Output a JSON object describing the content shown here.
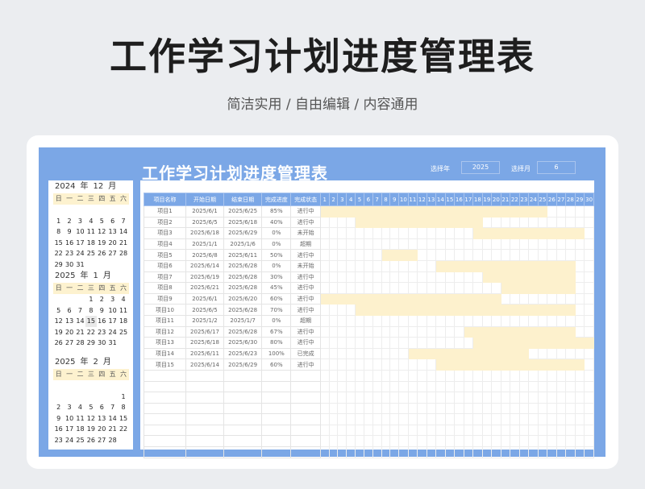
{
  "page": {
    "title": "工作学习计划进度管理表",
    "subtitle": "简洁实用 / 自由编辑 / 内容通用"
  },
  "sheet": {
    "title": "工作学习计划进度管理表",
    "year_label": "选择年",
    "year_value": "2025",
    "month_label": "选择月",
    "month_value": "6"
  },
  "calendars": [
    {
      "year": "2024",
      "year_unit": "年",
      "month": "12",
      "month_unit": "月",
      "weekdays": [
        "日",
        "一",
        "二",
        "三",
        "四",
        "五",
        "六"
      ],
      "days": [
        "",
        "",
        "",
        "",
        "",
        "",
        "",
        "1",
        "2",
        "3",
        "4",
        "5",
        "6",
        "7",
        "8",
        "9",
        "10",
        "11",
        "12",
        "13",
        "14",
        "15",
        "16",
        "17",
        "18",
        "19",
        "20",
        "21",
        "22",
        "23",
        "24",
        "25",
        "26",
        "27",
        "28",
        "29",
        "30",
        "31",
        "",
        "",
        "",
        ""
      ],
      "today": ""
    },
    {
      "year": "2025",
      "year_unit": "年",
      "month": "1",
      "month_unit": "月",
      "weekdays": [
        "日",
        "一",
        "二",
        "三",
        "四",
        "五",
        "六"
      ],
      "days": [
        "",
        "",
        "",
        "1",
        "2",
        "3",
        "4",
        "5",
        "6",
        "7",
        "8",
        "9",
        "10",
        "11",
        "12",
        "13",
        "14",
        "15",
        "16",
        "17",
        "18",
        "19",
        "20",
        "21",
        "22",
        "23",
        "24",
        "25",
        "26",
        "27",
        "28",
        "29",
        "30",
        "31",
        ""
      ],
      "today": "15"
    },
    {
      "year": "2025",
      "year_unit": "年",
      "month": "2",
      "month_unit": "月",
      "weekdays": [
        "日",
        "一",
        "二",
        "三",
        "四",
        "五",
        "六"
      ],
      "days": [
        "",
        "",
        "",
        "",
        "",
        "",
        "",
        "",
        "",
        "",
        "",
        "",
        "",
        "1",
        "2",
        "3",
        "4",
        "5",
        "6",
        "7",
        "8",
        "9",
        "10",
        "11",
        "12",
        "13",
        "14",
        "15",
        "16",
        "17",
        "18",
        "19",
        "20",
        "21",
        "22",
        "23",
        "24",
        "25",
        "26",
        "27",
        "28",
        ""
      ],
      "today": ""
    }
  ],
  "table": {
    "headers": [
      "项目名称",
      "开始日期",
      "结束日期",
      "完成进度",
      "完成状态"
    ],
    "days": [
      "1",
      "2",
      "3",
      "4",
      "5",
      "6",
      "7",
      "8",
      "9",
      "10",
      "11",
      "12",
      "13",
      "14",
      "15",
      "16",
      "17",
      "18",
      "19",
      "20",
      "21",
      "22",
      "23",
      "24",
      "25",
      "26",
      "27",
      "28",
      "29",
      "30"
    ],
    "rows": [
      {
        "name": "项目1",
        "start": "2025/6/1",
        "end": "2025/6/25",
        "progress": "85%",
        "status": "进行中",
        "s": 1,
        "e": 25
      },
      {
        "name": "项目2",
        "start": "2025/6/5",
        "end": "2025/6/18",
        "progress": "40%",
        "status": "进行中",
        "s": 5,
        "e": 18
      },
      {
        "name": "项目3",
        "start": "2025/6/18",
        "end": "2025/6/29",
        "progress": "0%",
        "status": "未开始",
        "s": 18,
        "e": 29
      },
      {
        "name": "项目4",
        "start": "2025/1/1",
        "end": "2025/1/6",
        "progress": "0%",
        "status": "超期",
        "s": 0,
        "e": 0
      },
      {
        "name": "项目5",
        "start": "2025/6/8",
        "end": "2025/6/11",
        "progress": "50%",
        "status": "进行中",
        "s": 8,
        "e": 11
      },
      {
        "name": "项目6",
        "start": "2025/6/14",
        "end": "2025/6/28",
        "progress": "0%",
        "status": "未开始",
        "s": 14,
        "e": 28
      },
      {
        "name": "项目7",
        "start": "2025/6/19",
        "end": "2025/6/28",
        "progress": "30%",
        "status": "进行中",
        "s": 19,
        "e": 28
      },
      {
        "name": "项目8",
        "start": "2025/6/21",
        "end": "2025/6/28",
        "progress": "45%",
        "status": "进行中",
        "s": 21,
        "e": 28
      },
      {
        "name": "项目9",
        "start": "2025/6/1",
        "end": "2025/6/20",
        "progress": "60%",
        "status": "进行中",
        "s": 1,
        "e": 20
      },
      {
        "name": "项目10",
        "start": "2025/6/5",
        "end": "2025/6/28",
        "progress": "70%",
        "status": "进行中",
        "s": 5,
        "e": 28
      },
      {
        "name": "项目11",
        "start": "2025/1/2",
        "end": "2025/1/7",
        "progress": "0%",
        "status": "超期",
        "s": 0,
        "e": 0
      },
      {
        "name": "项目12",
        "start": "2025/6/17",
        "end": "2025/6/28",
        "progress": "67%",
        "status": "进行中",
        "s": 17,
        "e": 28
      },
      {
        "name": "项目13",
        "start": "2025/6/18",
        "end": "2025/6/30",
        "progress": "80%",
        "status": "进行中",
        "s": 18,
        "e": 30
      },
      {
        "name": "项目14",
        "start": "2025/6/11",
        "end": "2025/6/23",
        "progress": "100%",
        "status": "已完成",
        "s": 11,
        "e": 23
      },
      {
        "name": "项目15",
        "start": "2025/6/14",
        "end": "2025/6/29",
        "progress": "60%",
        "status": "进行中",
        "s": 14,
        "e": 29
      }
    ],
    "empty_rows": 8
  },
  "colors": {
    "header_blue": "#7ba7e6",
    "bar_fill": "#fdf1cd",
    "weekday_fill": "#fdf2cf"
  }
}
